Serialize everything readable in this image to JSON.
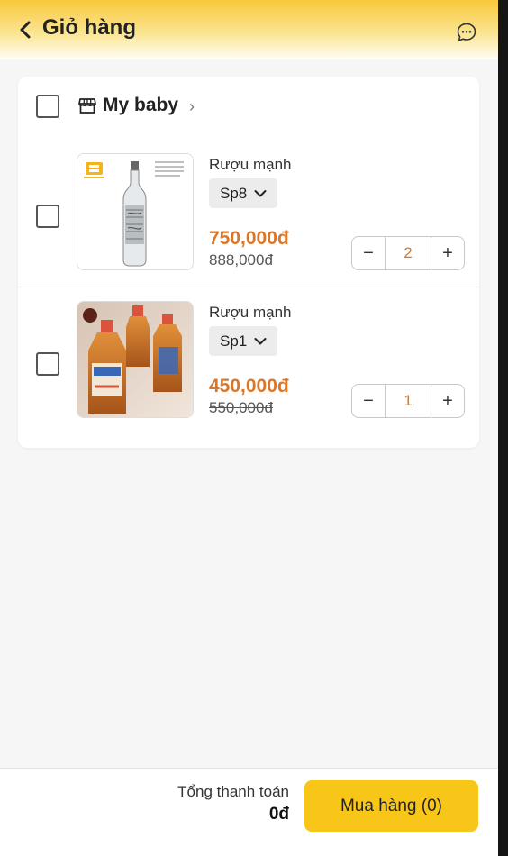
{
  "header": {
    "title": "Giỏ hàng"
  },
  "shop": {
    "name": "My baby"
  },
  "items": [
    {
      "name": "Rượu mạnh",
      "variant": "Sp8",
      "price": "750,000đ",
      "old_price": "888,000đ",
      "quantity": "2",
      "image": "vodka-bottle"
    },
    {
      "name": "Rượu mạnh",
      "variant": "Sp1",
      "price": "450,000đ",
      "old_price": "550,000đ",
      "quantity": "1",
      "image": "liquor-bottles"
    }
  ],
  "qty_controls": {
    "minus": "−",
    "plus": "+"
  },
  "footer": {
    "total_label": "Tổng thanh toán",
    "total_value": "0đ",
    "buy_label": "Mua hàng (0)"
  },
  "colors": {
    "accent": "#f8c519",
    "price": "#d9772a"
  }
}
